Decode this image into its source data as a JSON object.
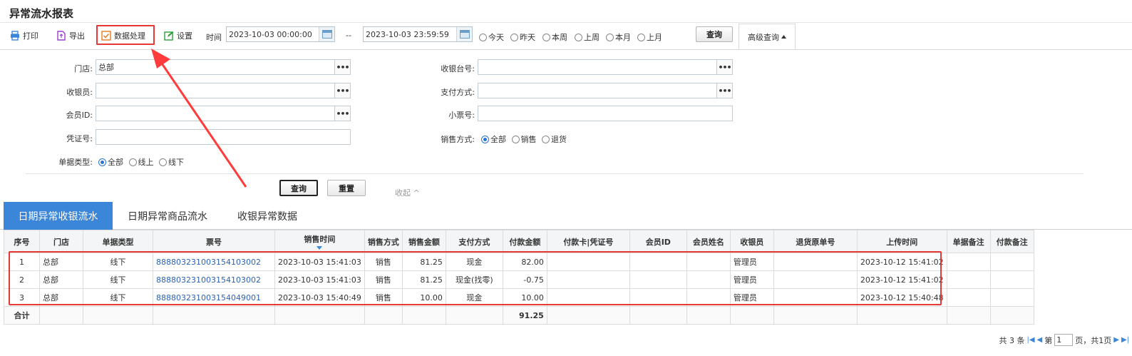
{
  "page": {
    "title": "异常流水报表"
  },
  "toolbar": {
    "print": "打印",
    "export": "导出",
    "data_process": "数据处理",
    "settings": "设置",
    "time_label": "时间",
    "start_time": "2023-10-03 00:00:00",
    "range_sep": "--",
    "end_time": "2023-10-03 23:59:59",
    "quick_ranges": [
      "今天",
      "昨天",
      "本周",
      "上周",
      "本月",
      "上月"
    ],
    "query": "查询",
    "advanced": "高级查询"
  },
  "filters": {
    "store_label": "门店:",
    "store_value": "总部",
    "cashier_label": "收银员:",
    "member_label": "会员ID:",
    "voucher_label": "凭证号:",
    "doc_type_label": "单据类型:",
    "doc_type_options": [
      "全部",
      "线上",
      "线下"
    ],
    "register_label": "收银台号:",
    "payment_label": "支付方式:",
    "receipt_label": "小票号:",
    "sale_mode_label": "销售方式:",
    "sale_mode_options": [
      "全部",
      "销售",
      "退货"
    ],
    "ellipsis": "•••",
    "query_btn": "查询",
    "reset_btn": "重置",
    "collapse": "收起 ^"
  },
  "tabs": [
    "日期异常收银流水",
    "日期异常商品流水",
    "收银异常数据"
  ],
  "table": {
    "columns": [
      "序号",
      "门店",
      "单据类型",
      "票号",
      "销售时间",
      "销售方式",
      "销售金额",
      "支付方式",
      "付款金额",
      "付款卡|凭证号",
      "会员ID",
      "会员姓名",
      "收银员",
      "退货原单号",
      "上传时间",
      "单据备注",
      "付款备注"
    ],
    "rows": [
      [
        "1",
        "总部",
        "线下",
        "888803231003154103002",
        "2023-10-03 15:41:03",
        "销售",
        "81.25",
        "现金",
        "82.00",
        "",
        "",
        "",
        "管理员",
        "",
        "2023-10-12 15:41:02",
        "",
        ""
      ],
      [
        "2",
        "总部",
        "线下",
        "888803231003154103002",
        "2023-10-03 15:41:03",
        "销售",
        "81.25",
        "现金(找零)",
        "-0.75",
        "",
        "",
        "",
        "管理员",
        "",
        "2023-10-12 15:41:02",
        "",
        ""
      ],
      [
        "3",
        "总部",
        "线下",
        "888803231003154049001",
        "2023-10-03 15:40:49",
        "销售",
        "10.00",
        "现金",
        "10.00",
        "",
        "",
        "",
        "管理员",
        "",
        "2023-10-12 15:40:48",
        "",
        ""
      ]
    ],
    "total_label": "合计",
    "total_payment": "91.25"
  },
  "pager": {
    "total": "共 3 条",
    "page_prefix": "第",
    "page_value": "1",
    "page_suffix": "页，共1页"
  },
  "colors": {
    "accent": "#3b86d8",
    "highlight": "#e53935",
    "link": "#2a63b6"
  }
}
